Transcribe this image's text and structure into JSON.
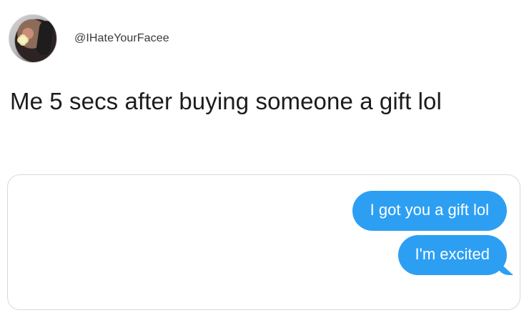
{
  "profile": {
    "handle": "@IHateYourFacee",
    "avatar_icon": "profile-avatar-icon"
  },
  "post": {
    "text": "Me 5 secs after buying someone a gift lol"
  },
  "messages": [
    {
      "text": "I got you a gift lol",
      "type": "sent"
    },
    {
      "text": "I'm excited",
      "type": "sent"
    }
  ],
  "colors": {
    "bubble_blue": "#2c9ff3",
    "background": "#ffffff",
    "border": "#d8d8d8"
  }
}
